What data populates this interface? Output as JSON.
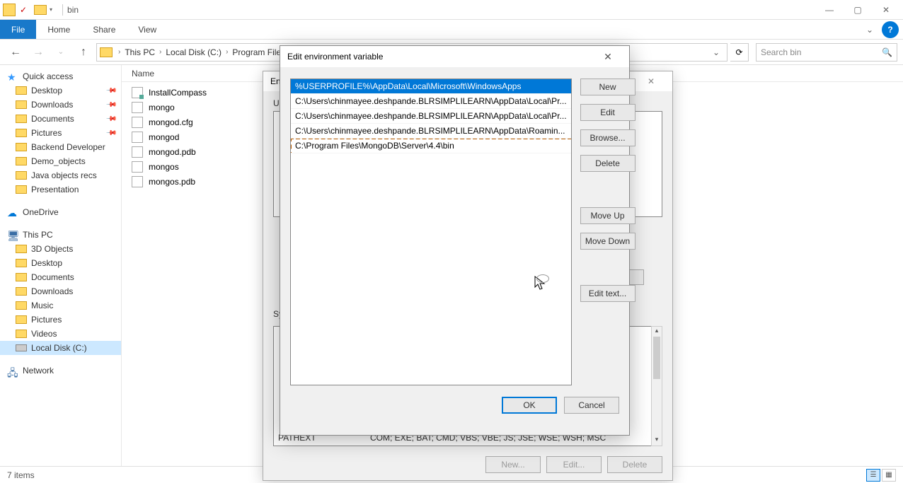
{
  "titlebar": {
    "title": "bin"
  },
  "ribbon": {
    "file": "File",
    "home": "Home",
    "share": "Share",
    "view": "View"
  },
  "breadcrumb": {
    "items": [
      "This PC",
      "Local Disk (C:)",
      "Program Files"
    ],
    "search_placeholder": "Search bin"
  },
  "sidebar": {
    "quick_access": "Quick access",
    "qa_items": [
      "Desktop",
      "Downloads",
      "Documents",
      "Pictures",
      "Backend Developer",
      "Demo_objects",
      "Java objects recs",
      "Presentation"
    ],
    "onedrive": "OneDrive",
    "this_pc": "This PC",
    "pc_items": [
      "3D Objects",
      "Desktop",
      "Documents",
      "Downloads",
      "Music",
      "Pictures",
      "Videos",
      "Local Disk (C:)"
    ],
    "network": "Network"
  },
  "file_header": {
    "name": "Name"
  },
  "files": [
    "InstallCompass",
    "mongo",
    "mongod.cfg",
    "mongod",
    "mongod.pdb",
    "mongos",
    "mongos.pdb"
  ],
  "status": {
    "count": "7 items"
  },
  "back_dialog": {
    "title": "Env",
    "user_label": "Us",
    "sys_label": "Sy",
    "pathext_key": "PATHEXT",
    "pathext_val": "COM; EXE; BAT; CMD; VBS; VBE; JS; JSE; WSE; WSH; MSC",
    "btn_new": "New...",
    "btn_edit": "Edit...",
    "btn_delete": "Delete",
    "side_e": "e"
  },
  "front_dialog": {
    "title": "Edit environment variable",
    "paths": [
      "%USERPROFILE%\\AppData\\Local\\Microsoft\\WindowsApps",
      "C:\\Users\\chinmayee.deshpande.BLRSIMPLILEARN\\AppData\\Local\\Pr...",
      "C:\\Users\\chinmayee.deshpande.BLRSIMPLILEARN\\AppData\\Local\\Pr...",
      "C:\\Users\\chinmayee.deshpande.BLRSIMPLILEARN\\AppData\\Roamin...",
      "C:\\Program Files\\MongoDB\\Server\\4.4\\bin"
    ],
    "btn_new": "New",
    "btn_edit": "Edit",
    "btn_browse": "Browse...",
    "btn_delete": "Delete",
    "btn_moveup": "Move Up",
    "btn_movedown": "Move Down",
    "btn_edittext": "Edit text...",
    "btn_ok": "OK",
    "btn_cancel": "Cancel"
  }
}
